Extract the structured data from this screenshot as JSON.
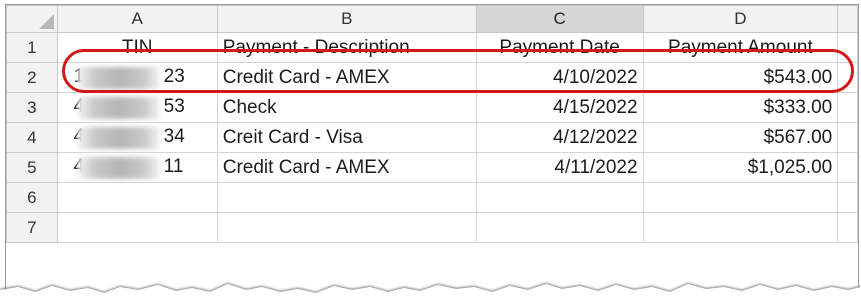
{
  "columns": [
    "A",
    "B",
    "C",
    "D"
  ],
  "rows": [
    "1",
    "2",
    "3",
    "4",
    "5",
    "6",
    "7"
  ],
  "header": {
    "tin": "TIN",
    "description": "Payment - Description",
    "date": "Payment Date",
    "amount": "Payment Amount"
  },
  "records": [
    {
      "tin_prefix": "1",
      "tin_suffix": "23",
      "description": "Credit Card - AMEX",
      "date": "4/10/2022",
      "amount": "$543.00"
    },
    {
      "tin_prefix": "4",
      "tin_suffix": "53",
      "description": "Check",
      "date": "4/15/2022",
      "amount": "$333.00"
    },
    {
      "tin_prefix": "4",
      "tin_suffix": "34",
      "description": "Creit Card - Visa",
      "date": "4/12/2022",
      "amount": "$567.00"
    },
    {
      "tin_prefix": "4",
      "tin_suffix": "11",
      "description": "Credit Card - AMEX",
      "date": "4/11/2022",
      "amount": "$1,025.00"
    }
  ],
  "selected_column": "C",
  "colors": {
    "highlight_oval": "#d41717",
    "header_bg": "#f2f2f2",
    "selected_header_bg": "#d6d6d6"
  }
}
